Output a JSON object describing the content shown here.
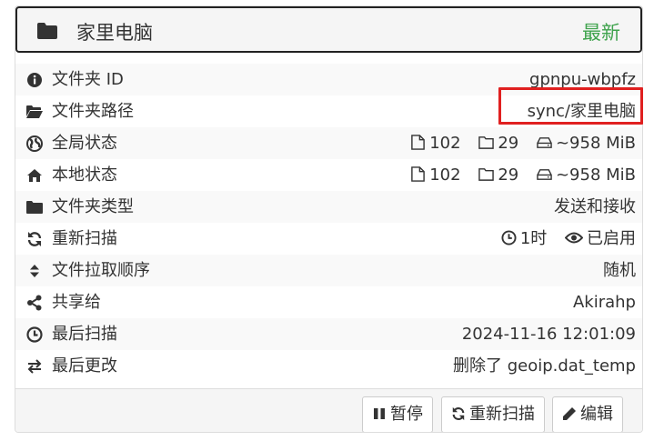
{
  "panel": {
    "title": "家里电脑",
    "status": "最新",
    "status_color": "#3fa34d",
    "title_icon": "folder-icon"
  },
  "rows": [
    {
      "icon": "info-icon",
      "label": "文件夹 ID",
      "value": "gpnpu-wbpfz"
    },
    {
      "icon": "folder-open-icon",
      "label": "文件夹路径",
      "value": "sync/家里电脑"
    },
    {
      "icon": "globe-icon",
      "label": "全局状态",
      "files": "102",
      "dirs": "29",
      "size": "~958 MiB"
    },
    {
      "icon": "home-icon",
      "label": "本地状态",
      "files": "102",
      "dirs": "29",
      "size": "~958 MiB"
    },
    {
      "icon": "folder-icon",
      "label": "文件夹类型",
      "value": "发送和接收"
    },
    {
      "icon": "refresh-icon",
      "label": "重新扫描",
      "interval": "1时",
      "watcher": "已启用"
    },
    {
      "icon": "sort-icon",
      "label": "文件拉取顺序",
      "value": "随机"
    },
    {
      "icon": "share-icon",
      "label": "共享给",
      "value": "Akirahp"
    },
    {
      "icon": "clock-icon",
      "label": "最后扫描",
      "value": "2024-11-16 12:01:09"
    },
    {
      "icon": "exchange-icon",
      "label": "最后更改",
      "value": "删除了 geoip.dat_temp"
    }
  ],
  "buttons": {
    "pause": "暂停",
    "rescan": "重新扫描",
    "edit": "编辑"
  },
  "highlight_color": "#e02020"
}
